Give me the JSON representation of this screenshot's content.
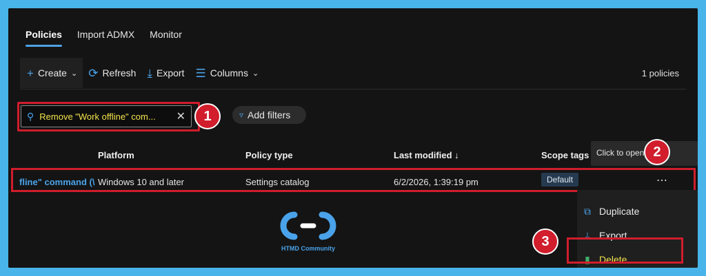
{
  "tabs": [
    {
      "label": "Policies",
      "active": true
    },
    {
      "label": "Import ADMX",
      "active": false
    },
    {
      "label": "Monitor",
      "active": false
    }
  ],
  "toolbar": {
    "create_label": "Create",
    "refresh_label": "Refresh",
    "export_label": "Export",
    "columns_label": "Columns",
    "count_text": "1 policies"
  },
  "search": {
    "value": "Remove \"Work offline\" com...",
    "icon": "search-icon"
  },
  "filters": {
    "label": "Add filters"
  },
  "table": {
    "columns": [
      "Platform",
      "Policy type",
      "Last modified ↓",
      "Scope tags"
    ],
    "row": {
      "name": "fline\" command (\\",
      "platform": "Windows 10 and later",
      "policy_type": "Settings catalog",
      "last_modified": "6/2/2026, 1:39:19 pm",
      "scope_tag": "Default"
    }
  },
  "tooltip": {
    "text": "Click to open menu"
  },
  "context_menu": {
    "items": [
      {
        "label": "Duplicate",
        "icon": "copy-icon"
      },
      {
        "label": "Export",
        "icon": "download-icon"
      },
      {
        "label": "Delete",
        "icon": "trash-icon"
      }
    ]
  },
  "annotations": {
    "step1": "1",
    "step2": "2",
    "step3": "3"
  },
  "logo": {
    "text": "HTMD Community"
  },
  "colors": {
    "accent": "#4aa3ea",
    "highlight_outline": "#d11d2c",
    "search_text": "#f2e34b",
    "background_frame": "#49b4ea"
  }
}
